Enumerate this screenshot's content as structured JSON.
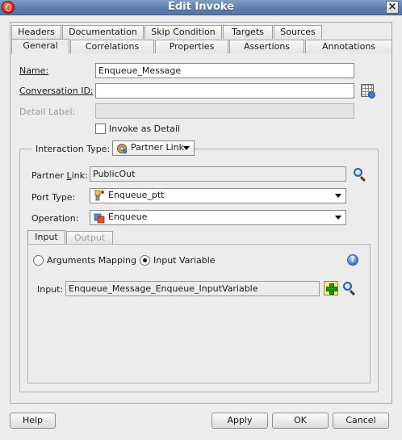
{
  "window": {
    "title": "Edit Invoke"
  },
  "tabs_top": [
    "Headers",
    "Documentation",
    "Skip Condition",
    "Targets",
    "Sources"
  ],
  "tabs_bottom": [
    "General",
    "Correlations",
    "Properties",
    "Assertions",
    "Annotations"
  ],
  "selected_tab": "General",
  "form": {
    "name_label": "Name:",
    "name_value": "Enqueue_Message",
    "conversation_label": "Conversation ID:",
    "conversation_value": "",
    "detail_label": "Detail Label:",
    "detail_value": "",
    "invoke_as_detail_label": "Invoke as Detail",
    "invoke_as_detail_checked": false
  },
  "interaction": {
    "label": "Interaction Type:",
    "type_value": "Partner Link",
    "partner_link_label": "Partner Link:",
    "partner_link_value": "PublicOut",
    "port_type_label": "Port Type:",
    "port_type_value": "Enqueue_ptt",
    "operation_label": "Operation:",
    "operation_value": "Enqueue"
  },
  "io_tabs": {
    "input": "Input",
    "output": "Output",
    "selected": "Input"
  },
  "input_panel": {
    "arguments_mapping_label": "Arguments Mapping",
    "input_variable_label": "Input Variable",
    "selected_mode": "Input Variable",
    "input_label": "Input:",
    "input_value": "Enqueue_Message_Enqueue_InputVariable"
  },
  "buttons": {
    "help": "Help",
    "apply": "Apply",
    "ok": "OK",
    "cancel": "Cancel"
  },
  "icons": {
    "app_logo": "oracle-logo-icon",
    "close": "close-icon",
    "conversation_browse": "grid-browse-icon",
    "partner_link_search": "search-icon",
    "help": "help-icon",
    "add": "add-icon",
    "input_search": "search-icon"
  }
}
